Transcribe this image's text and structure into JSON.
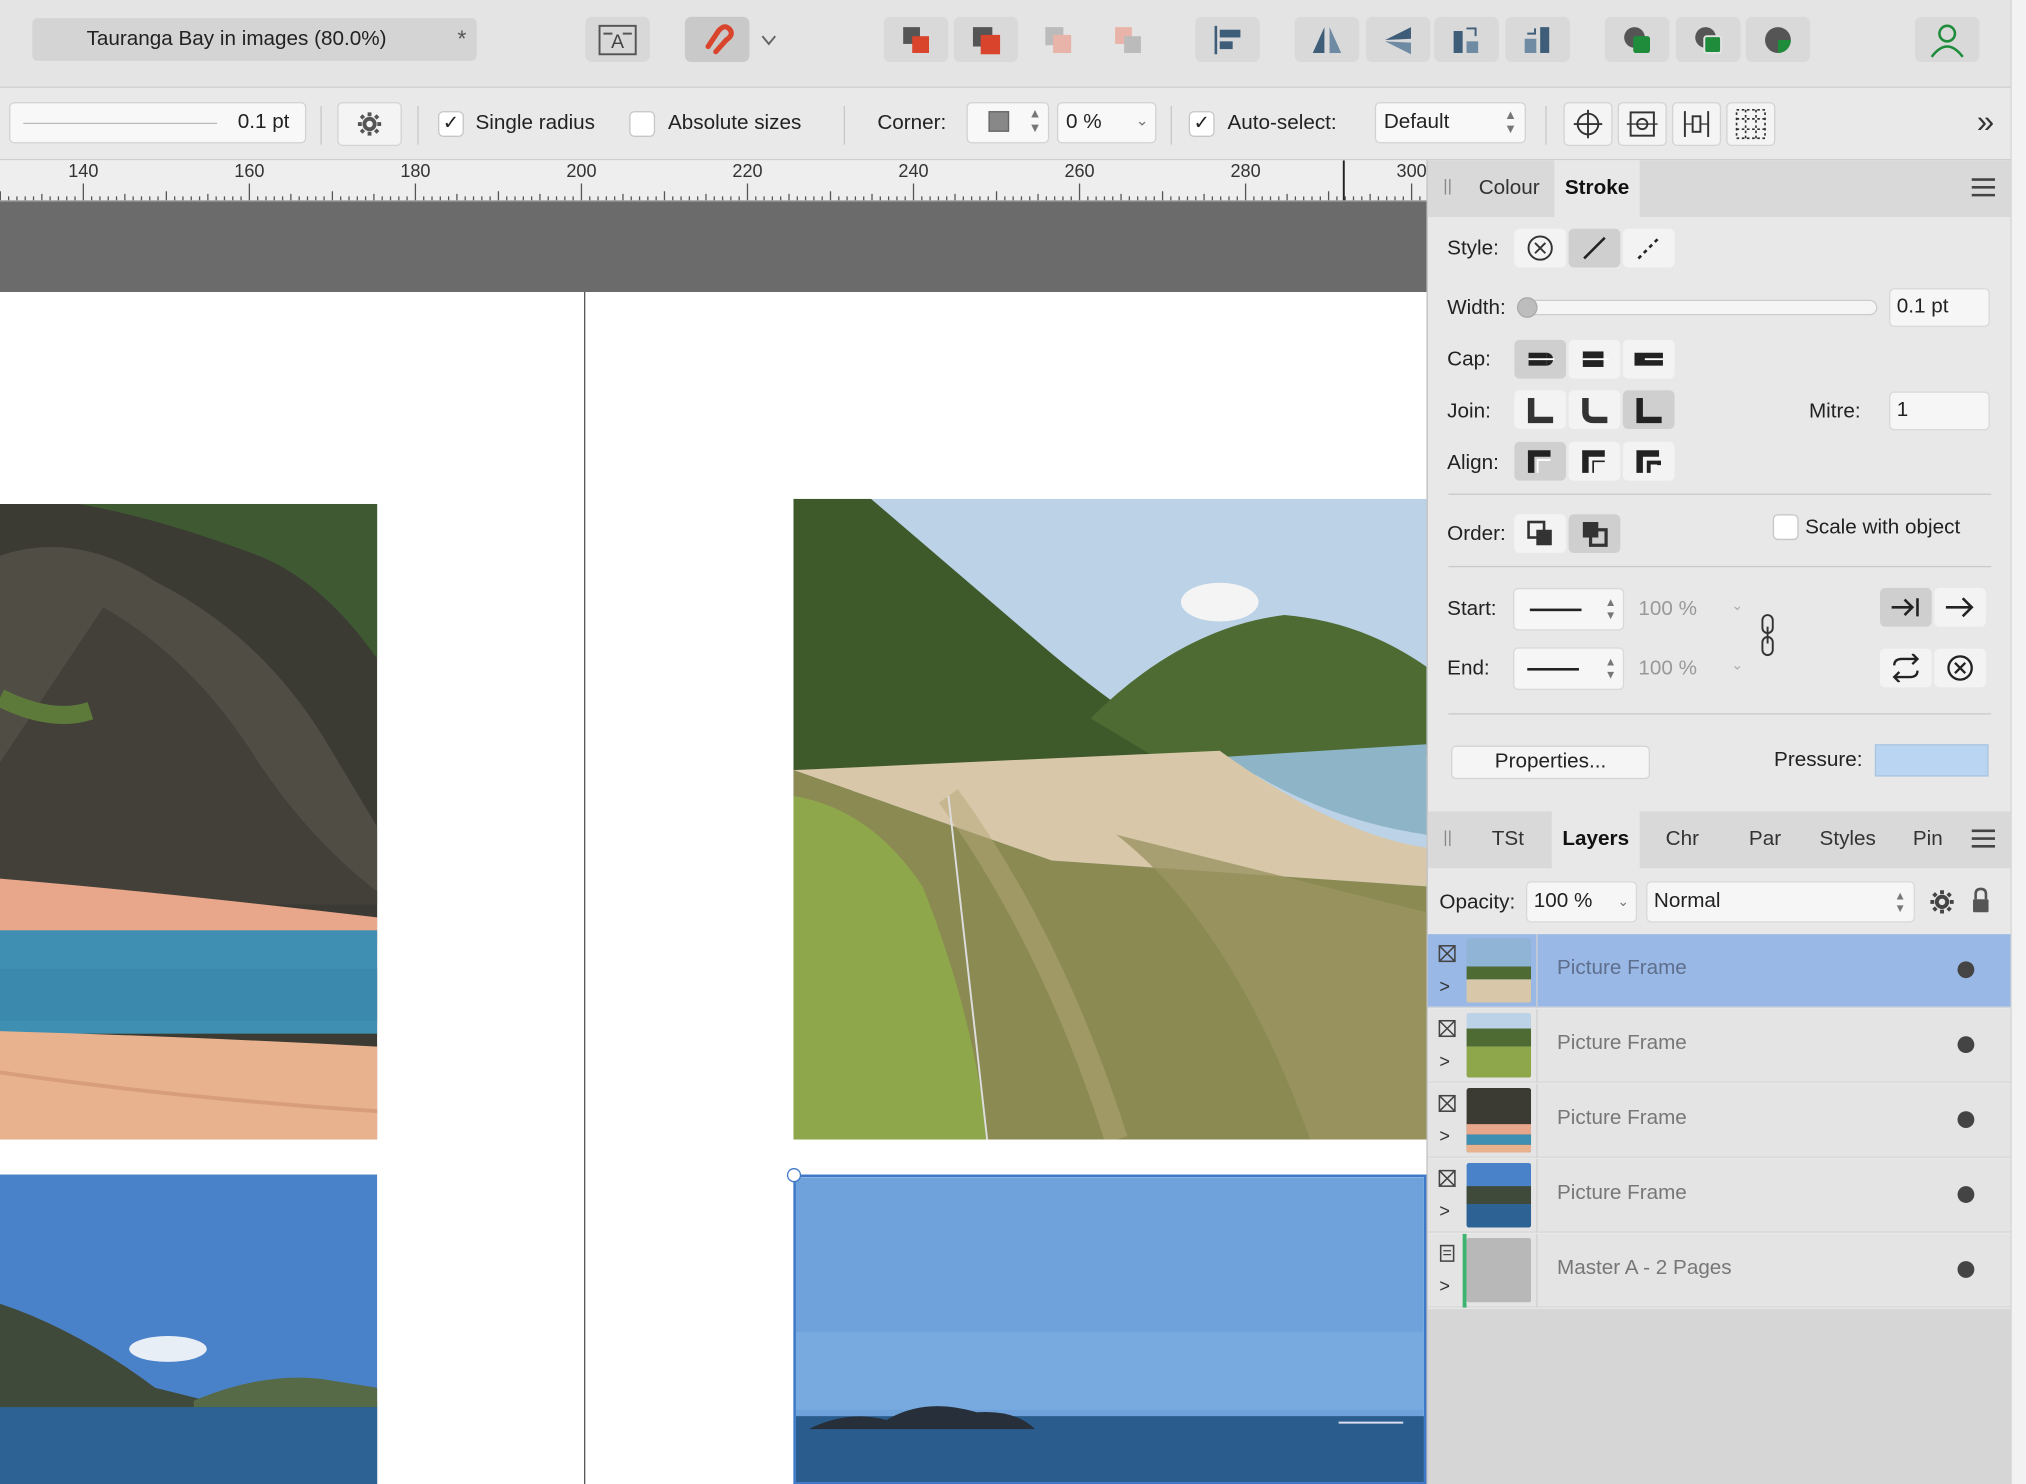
{
  "document_tab": {
    "title": "Tauranga Bay in images (80.0%)",
    "modified_marker": "*"
  },
  "toolbar_icons": [
    "text-frame-icon",
    "snapping-magnet-icon",
    "dropdown-arrow-icon",
    "move-to-front-icon",
    "move-forward-icon",
    "move-backward-icon",
    "move-to-back-icon",
    "align-left-icon",
    "flip-horizontal-icon",
    "flip-vertical-icon",
    "rotate-left-icon",
    "rotate-right-icon",
    "add-geometry-icon",
    "subtract-geometry-icon",
    "intersect-geometry-icon",
    "user-account-icon"
  ],
  "context_bar": {
    "stroke_width": "0.1 pt",
    "single_radius_label": "Single radius",
    "single_radius_checked": true,
    "absolute_sizes_label": "Absolute sizes",
    "absolute_sizes_checked": false,
    "corner_label": "Corner:",
    "corner_value": "0 %",
    "auto_select_label": "Auto-select:",
    "auto_select_checked": true,
    "auto_select_value": "Default",
    "overflow": "»"
  },
  "ruler": {
    "labels": [
      "140",
      "160",
      "180",
      "200",
      "220",
      "240",
      "260",
      "280",
      "300"
    ]
  },
  "stroke_panel": {
    "tabs": [
      "Colour",
      "Stroke"
    ],
    "active_tab": "Stroke",
    "style_label": "Style:",
    "width_label": "Width:",
    "width_value": "0.1 pt",
    "cap_label": "Cap:",
    "join_label": "Join:",
    "mitre_label": "Mitre:",
    "mitre_value": "1",
    "align_label": "Align:",
    "order_label": "Order:",
    "scale_with_object_label": "Scale with object",
    "scale_with_object_checked": false,
    "start_label": "Start:",
    "start_percent": "100 %",
    "end_label": "End:",
    "end_percent": "100 %",
    "properties_button": "Properties...",
    "pressure_label": "Pressure:"
  },
  "layers_panel": {
    "tabs": [
      "TSt",
      "Layers",
      "Chr",
      "Par",
      "Styles",
      "Pin"
    ],
    "active_tab": "Layers",
    "opacity_label": "Opacity:",
    "opacity_value": "100 %",
    "blend_mode": "Normal",
    "layers": [
      {
        "name": "Picture Frame",
        "selected": true
      },
      {
        "name": "Picture Frame",
        "selected": false
      },
      {
        "name": "Picture Frame",
        "selected": false
      },
      {
        "name": "Picture Frame",
        "selected": false
      },
      {
        "name": "Master A - 2 Pages",
        "selected": false
      }
    ]
  },
  "colors": {
    "selection_blue": "#9ab8e6",
    "accent_red": "#d9442c",
    "accent_green": "#1e8c3a"
  }
}
